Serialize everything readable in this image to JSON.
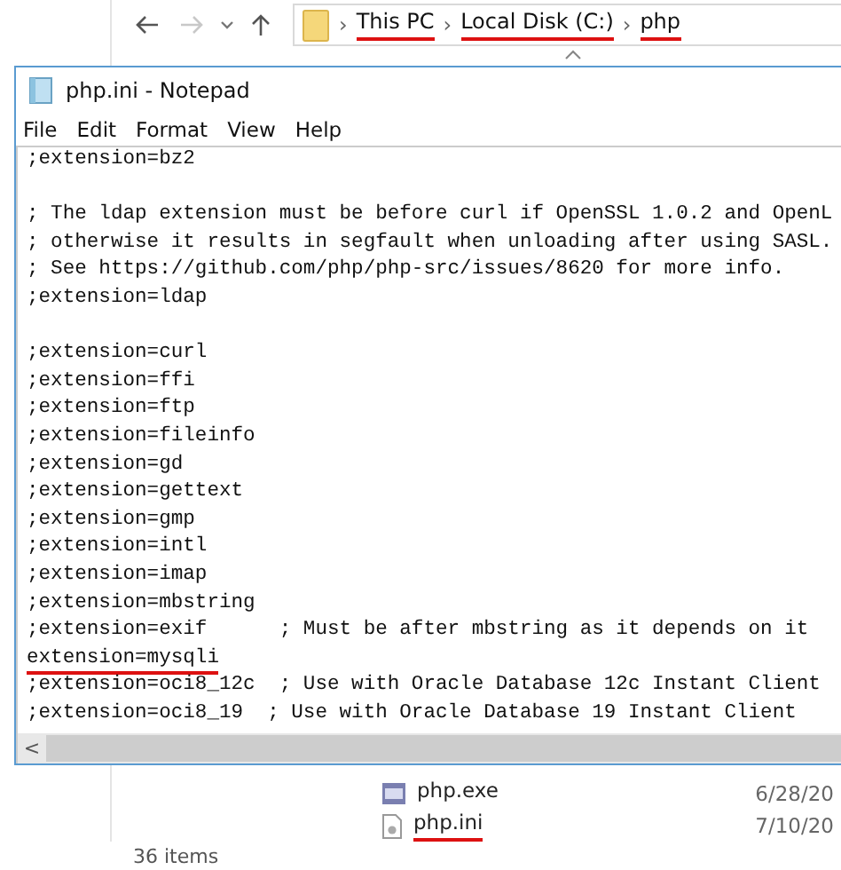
{
  "explorer": {
    "breadcrumb": {
      "separator": "›",
      "parts": [
        "This PC",
        "Local Disk (C:)",
        "php"
      ],
      "underlined": true
    },
    "files": [
      {
        "name": "php.exe",
        "date": "6/28/20",
        "kind": "exe",
        "underlined": false
      },
      {
        "name": "php.ini",
        "date": "7/10/20",
        "kind": "ini",
        "underlined": true
      }
    ],
    "status_bar": "36 items"
  },
  "notepad": {
    "title": "php.ini - Notepad",
    "menu": [
      "File",
      "Edit",
      "Format",
      "View",
      "Help"
    ],
    "lines": [
      {
        "text": ";extension=bz2",
        "blank_line_before": false,
        "underlined": false
      },
      {
        "text": "; The ldap extension must be before curl if OpenSSL 1.0.2 and OpenL",
        "blank_line_before": true,
        "underlined": false
      },
      {
        "text": "; otherwise it results in segfault when unloading after using SASL.",
        "blank_line_before": false,
        "underlined": false
      },
      {
        "text": "; See https://github.com/php/php-src/issues/8620 for more info.",
        "blank_line_before": false,
        "underlined": false
      },
      {
        "text": ";extension=ldap",
        "blank_line_before": false,
        "underlined": false
      },
      {
        "text": ";extension=curl",
        "blank_line_before": true,
        "underlined": false
      },
      {
        "text": ";extension=ffi",
        "blank_line_before": false,
        "underlined": false
      },
      {
        "text": ";extension=ftp",
        "blank_line_before": false,
        "underlined": false
      },
      {
        "text": ";extension=fileinfo",
        "blank_line_before": false,
        "underlined": false
      },
      {
        "text": ";extension=gd",
        "blank_line_before": false,
        "underlined": false
      },
      {
        "text": ";extension=gettext",
        "blank_line_before": false,
        "underlined": false
      },
      {
        "text": ";extension=gmp",
        "blank_line_before": false,
        "underlined": false
      },
      {
        "text": ";extension=intl",
        "blank_line_before": false,
        "underlined": false
      },
      {
        "text": ";extension=imap",
        "blank_line_before": false,
        "underlined": false
      },
      {
        "text": ";extension=mbstring",
        "blank_line_before": false,
        "underlined": false
      },
      {
        "text": ";extension=exif      ; Must be after mbstring as it depends on it",
        "blank_line_before": false,
        "underlined": false
      },
      {
        "text": "extension=mysqli",
        "blank_line_before": false,
        "underlined": true
      },
      {
        "text": ";extension=oci8_12c  ; Use with Oracle Database 12c Instant Client",
        "blank_line_before": false,
        "underlined": false
      },
      {
        "text": ";extension=oci8_19  ; Use with Oracle Database 19 Instant Client",
        "blank_line_before": false,
        "underlined": false
      }
    ],
    "scroll_left": "<"
  }
}
